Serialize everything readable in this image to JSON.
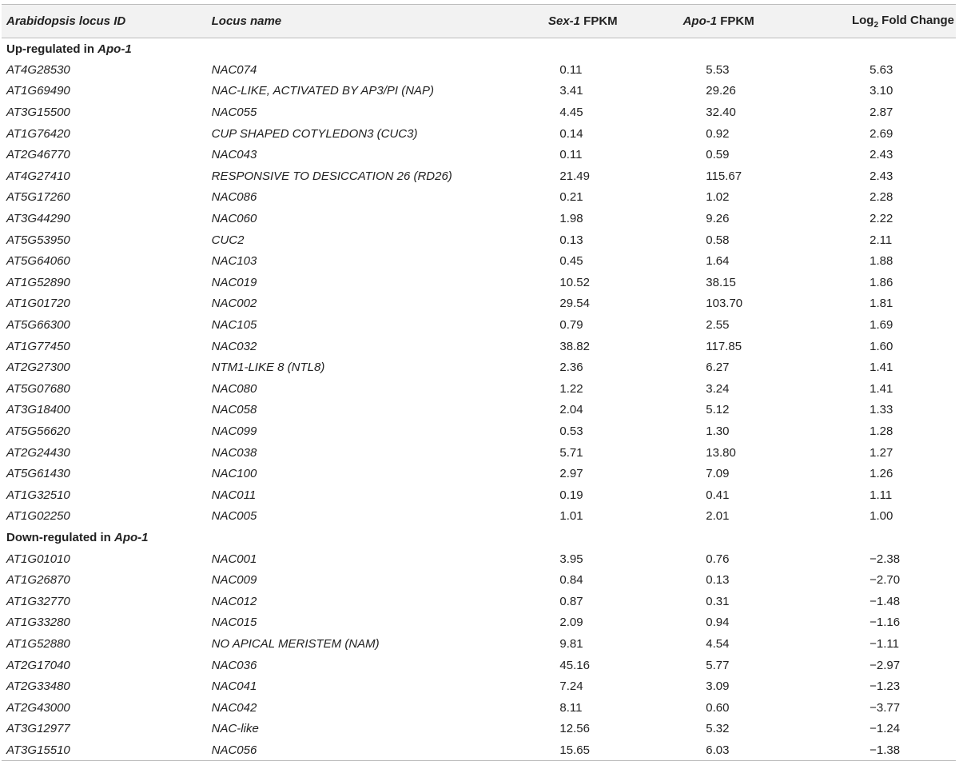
{
  "table": {
    "headers": {
      "locus_id": "Arabidopsis locus ID",
      "locus_name": "Locus name",
      "sex_prefix": "Sex-1",
      "sex_suffix": " FPKM",
      "apo_prefix": "Apo-1",
      "apo_suffix": " FPKM",
      "log_prefix": "Log",
      "log_sub": "2",
      "log_suffix": " Fold Change"
    },
    "sections": [
      {
        "label_prefix": "Up-regulated in ",
        "label_italic": "Apo-1",
        "rows": [
          {
            "id": "AT4G28530",
            "name": "NAC074",
            "sex": "0.11",
            "apo": "5.53",
            "fc": "5.63"
          },
          {
            "id": "AT1G69490",
            "name": "NAC-LIKE, ACTIVATED BY AP3/PI (NAP)",
            "sex": "3.41",
            "apo": "29.26",
            "fc": "3.10"
          },
          {
            "id": "AT3G15500",
            "name": "NAC055",
            "sex": "4.45",
            "apo": "32.40",
            "fc": "2.87"
          },
          {
            "id": "AT1G76420",
            "name": "CUP SHAPED COTYLEDON3 (CUC3)",
            "sex": "0.14",
            "apo": "0.92",
            "fc": "2.69"
          },
          {
            "id": "AT2G46770",
            "name": "NAC043",
            "sex": "0.11",
            "apo": "0.59",
            "fc": "2.43"
          },
          {
            "id": "AT4G27410",
            "name": "RESPONSIVE TO DESICCATION 26 (RD26)",
            "sex": "21.49",
            "apo": "115.67",
            "fc": "2.43"
          },
          {
            "id": "AT5G17260",
            "name": "NAC086",
            "sex": "0.21",
            "apo": "1.02",
            "fc": "2.28"
          },
          {
            "id": "AT3G44290",
            "name": "NAC060",
            "sex": "1.98",
            "apo": "9.26",
            "fc": "2.22"
          },
          {
            "id": "AT5G53950",
            "name": "CUC2",
            "sex": "0.13",
            "apo": "0.58",
            "fc": "2.11"
          },
          {
            "id": "AT5G64060",
            "name": "NAC103",
            "sex": "0.45",
            "apo": "1.64",
            "fc": "1.88"
          },
          {
            "id": "AT1G52890",
            "name": "NAC019",
            "sex": "10.52",
            "apo": "38.15",
            "fc": "1.86"
          },
          {
            "id": "AT1G01720",
            "name": "NAC002",
            "sex": "29.54",
            "apo": "103.70",
            "fc": "1.81"
          },
          {
            "id": "AT5G66300",
            "name": "NAC105",
            "sex": "0.79",
            "apo": "2.55",
            "fc": "1.69"
          },
          {
            "id": "AT1G77450",
            "name": "NAC032",
            "sex": "38.82",
            "apo": "117.85",
            "fc": "1.60"
          },
          {
            "id": "AT2G27300",
            "name": "NTM1-LIKE 8 (NTL8)",
            "sex": "2.36",
            "apo": "6.27",
            "fc": "1.41"
          },
          {
            "id": "AT5G07680",
            "name": "NAC080",
            "sex": "1.22",
            "apo": "3.24",
            "fc": "1.41"
          },
          {
            "id": "AT3G18400",
            "name": "NAC058",
            "sex": "2.04",
            "apo": "5.12",
            "fc": "1.33"
          },
          {
            "id": "AT5G56620",
            "name": "NAC099",
            "sex": "0.53",
            "apo": "1.30",
            "fc": "1.28"
          },
          {
            "id": "AT2G24430",
            "name": "NAC038",
            "sex": "5.71",
            "apo": "13.80",
            "fc": "1.27"
          },
          {
            "id": "AT5G61430",
            "name": "NAC100",
            "sex": "2.97",
            "apo": "7.09",
            "fc": "1.26"
          },
          {
            "id": "AT1G32510",
            "name": "NAC011",
            "sex": "0.19",
            "apo": "0.41",
            "fc": "1.11"
          },
          {
            "id": "AT1G02250",
            "name": "NAC005",
            "sex": "1.01",
            "apo": "2.01",
            "fc": "1.00"
          }
        ]
      },
      {
        "label_prefix": "Down-regulated in ",
        "label_italic": "Apo-1",
        "rows": [
          {
            "id": "AT1G01010",
            "name": "NAC001",
            "sex": "3.95",
            "apo": "0.76",
            "fc": "−2.38"
          },
          {
            "id": "AT1G26870",
            "name": "NAC009",
            "sex": "0.84",
            "apo": "0.13",
            "fc": "−2.70"
          },
          {
            "id": "AT1G32770",
            "name": "NAC012",
            "sex": "0.87",
            "apo": "0.31",
            "fc": "−1.48"
          },
          {
            "id": "AT1G33280",
            "name": "NAC015",
            "sex": "2.09",
            "apo": "0.94",
            "fc": "−1.16"
          },
          {
            "id": "AT1G52880",
            "name": "NO APICAL MERISTEM (NAM)",
            "sex": "9.81",
            "apo": "4.54",
            "fc": "−1.11"
          },
          {
            "id": "AT2G17040",
            "name": "NAC036",
            "sex": "45.16",
            "apo": "5.77",
            "fc": "−2.97"
          },
          {
            "id": "AT2G33480",
            "name": "NAC041",
            "sex": "7.24",
            "apo": "3.09",
            "fc": "−1.23"
          },
          {
            "id": "AT2G43000",
            "name": "NAC042",
            "sex": "8.11",
            "apo": "0.60",
            "fc": "−3.77"
          },
          {
            "id": "AT3G12977",
            "name": "NAC-like",
            "sex": "12.56",
            "apo": "5.32",
            "fc": "−1.24"
          },
          {
            "id": "AT3G15510",
            "name": "NAC056",
            "sex": "15.65",
            "apo": "6.03",
            "fc": "−1.38"
          }
        ]
      }
    ]
  }
}
